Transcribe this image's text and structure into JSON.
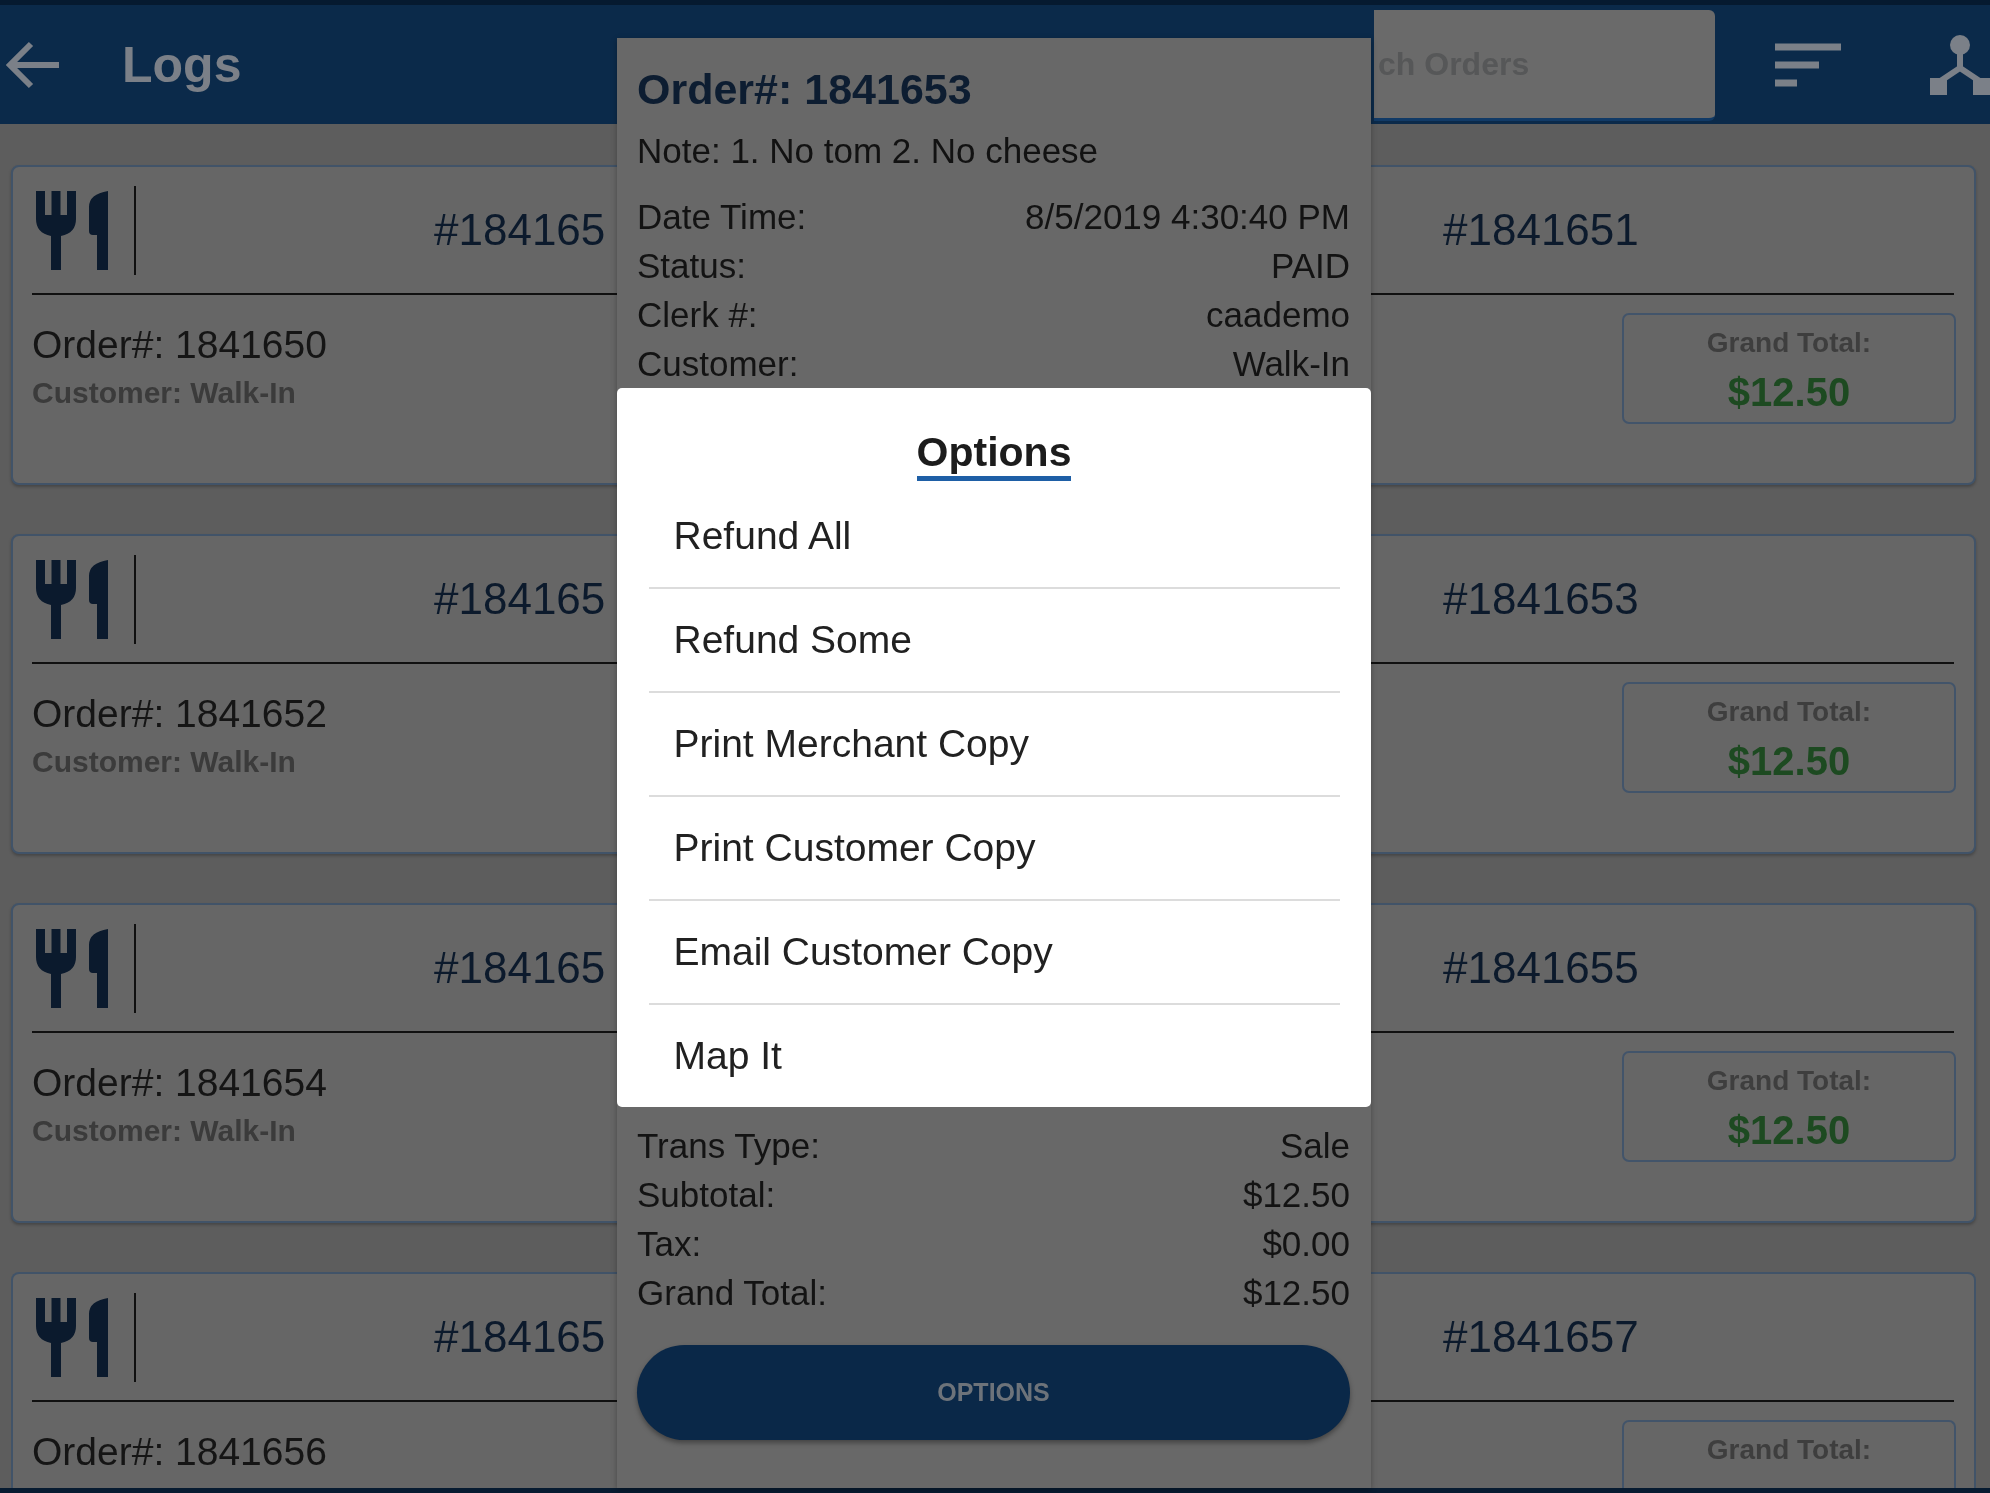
{
  "app_bar": {
    "title": "Logs",
    "search": {
      "placeholder": "ch Orders"
    }
  },
  "orders": [
    {
      "number": "#184165",
      "order": "Order#: 1841650",
      "customer": "Customer: Walk-In"
    },
    {
      "number": "#1841651",
      "total_label": "Grand Total:",
      "total": "$12.50"
    },
    {
      "number": "#184165",
      "order": "Order#: 1841652",
      "customer": "Customer: Walk-In"
    },
    {
      "number": "#1841653",
      "total_label": "Grand Total:",
      "total": "$12.50"
    },
    {
      "number": "#184165",
      "order": "Order#: 1841654",
      "customer": "Customer: Walk-In"
    },
    {
      "number": "#1841655",
      "total_label": "Grand Total:",
      "total": "$12.50"
    },
    {
      "number": "#184165",
      "order": "Order#: 1841656"
    },
    {
      "number": "#1841657",
      "total_label": "Grand Total:"
    }
  ],
  "order_detail": {
    "title": "Order#: 1841653",
    "note": "Note: 1. No tom 2. No cheese",
    "fields_upper": [
      {
        "label": "Date Time:",
        "value": "8/5/2019 4:30:40 PM"
      },
      {
        "label": "Status:",
        "value": "PAID"
      },
      {
        "label": "Clerk #:",
        "value": "caademo"
      },
      {
        "label": "Customer:",
        "value": "Walk-In"
      }
    ],
    "fields_lower": [
      {
        "label": "Trans Type:",
        "value": "Sale"
      },
      {
        "label": "Subtotal:",
        "value": "$12.50"
      },
      {
        "label": "Tax:",
        "value": "$0.00"
      },
      {
        "label": "Grand Total:",
        "value": "$12.50"
      }
    ],
    "button": "OPTIONS"
  },
  "options_dialog": {
    "title": "Options",
    "items": [
      "Refund All",
      "Refund Some",
      "Print Merchant Copy",
      "Print Customer Copy",
      "Email Customer Copy",
      "Map It"
    ]
  }
}
